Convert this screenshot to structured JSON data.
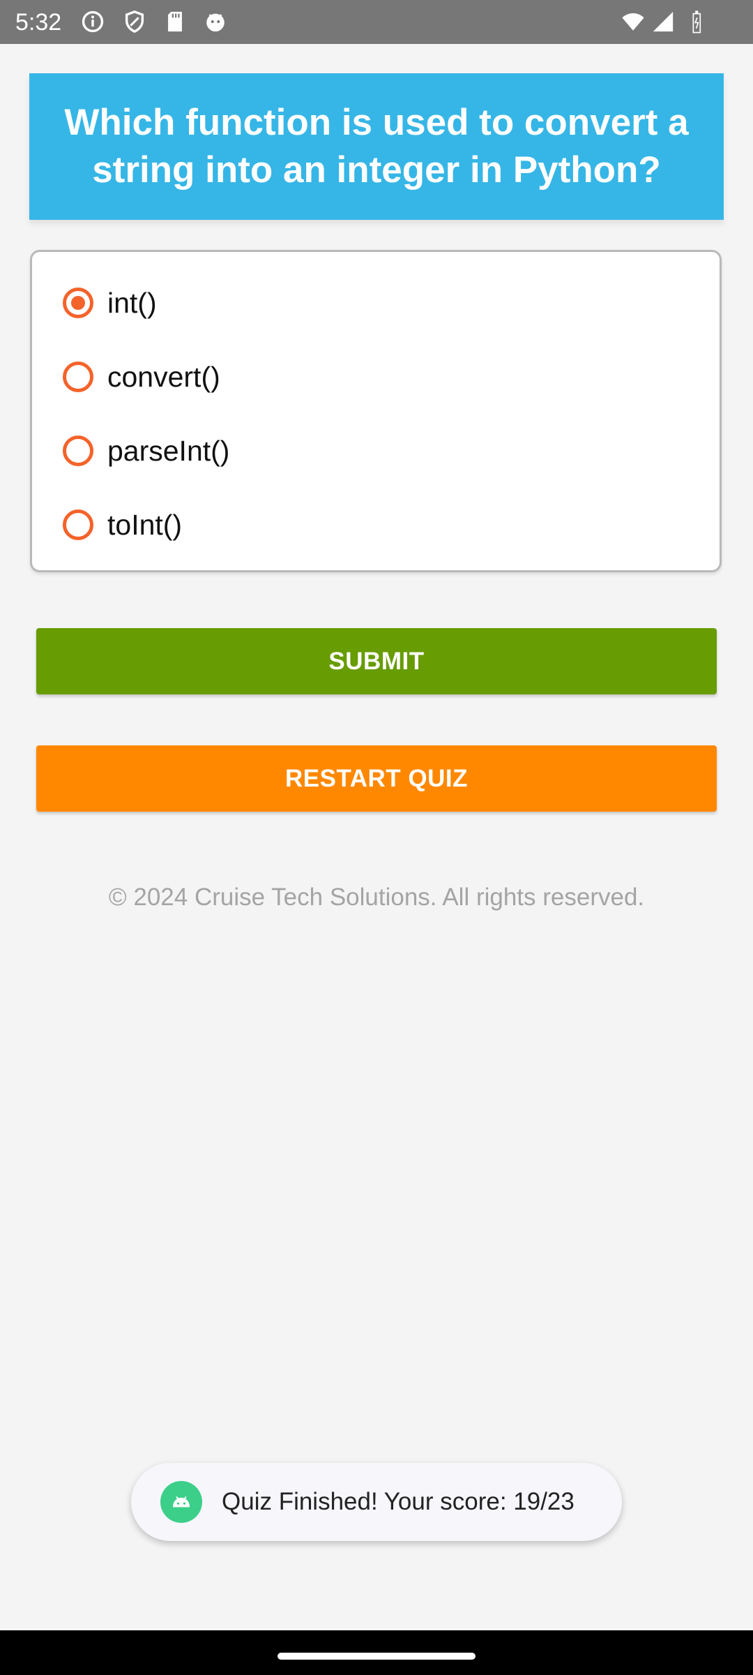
{
  "status_bar": {
    "time": "5:32",
    "left_icons": [
      "info-icon",
      "shield-icon",
      "sd-card-icon",
      "android-face-icon"
    ],
    "right_icons": [
      "wifi-icon",
      "signal-icon",
      "battery-icon"
    ]
  },
  "question": {
    "text": "Which function is used to convert a string into an integer in Python?"
  },
  "options": [
    {
      "label": "int()",
      "selected": true
    },
    {
      "label": "convert()",
      "selected": false
    },
    {
      "label": "parseInt()",
      "selected": false
    },
    {
      "label": "toInt()",
      "selected": false
    }
  ],
  "buttons": {
    "submit_label": "SUBMIT",
    "restart_label": "RESTART QUIZ"
  },
  "footer": {
    "text": "© 2024 Cruise Tech Solutions. All rights reserved."
  },
  "toast": {
    "text": "Quiz Finished! Your score: 19/23"
  },
  "colors": {
    "question_bg": "#36b6e6",
    "radio_accent": "#f4632a",
    "submit_bg": "#679c02",
    "restart_bg": "#ff8800"
  }
}
